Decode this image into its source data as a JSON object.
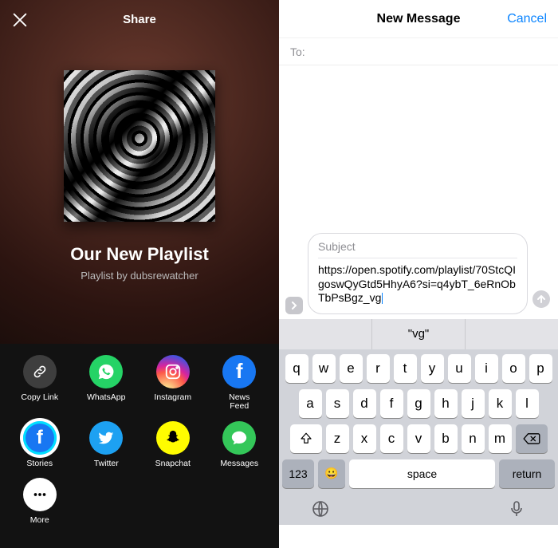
{
  "spotify": {
    "header_title": "Share",
    "playlist_title": "Our New Playlist",
    "playlist_sub": "Playlist by dubsrewatcher",
    "share_targets": [
      {
        "label": "Copy Link",
        "icon": "link"
      },
      {
        "label": "WhatsApp",
        "icon": "whatsapp"
      },
      {
        "label": "Instagram",
        "icon": "instagram"
      },
      {
        "label": "News\nFeed",
        "icon": "facebook"
      },
      {
        "label": "Stories",
        "icon": "stories"
      },
      {
        "label": "Twitter",
        "icon": "twitter"
      },
      {
        "label": "Snapchat",
        "icon": "snapchat"
      },
      {
        "label": "Messages",
        "icon": "messages"
      },
      {
        "label": "More",
        "icon": "more"
      }
    ]
  },
  "messages": {
    "header_title": "New Message",
    "cancel_label": "Cancel",
    "to_label": "To:",
    "subject_placeholder": "Subject",
    "body_text": "https://open.spotify.com/playlist/70StcQIgoswQyGtd5HhyA6?si=q4ybT_6eRnObTbPsBgz_vg",
    "prediction": "\"vg\"",
    "space_label": "space",
    "return_label": "return",
    "num_label": "123",
    "rows": {
      "r1": [
        "q",
        "w",
        "e",
        "r",
        "t",
        "y",
        "u",
        "i",
        "o",
        "p"
      ],
      "r2": [
        "a",
        "s",
        "d",
        "f",
        "g",
        "h",
        "j",
        "k",
        "l"
      ],
      "r3": [
        "z",
        "x",
        "c",
        "v",
        "b",
        "n",
        "m"
      ]
    }
  },
  "colors": {
    "ios_blue": "#0a84ff"
  }
}
